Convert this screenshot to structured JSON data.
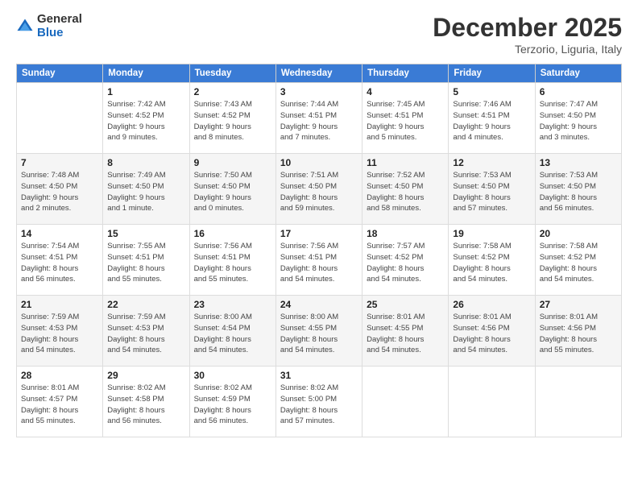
{
  "logo": {
    "general": "General",
    "blue": "Blue"
  },
  "title": "December 2025",
  "subtitle": "Terzorio, Liguria, Italy",
  "weekdays": [
    "Sunday",
    "Monday",
    "Tuesday",
    "Wednesday",
    "Thursday",
    "Friday",
    "Saturday"
  ],
  "weeks": [
    [
      {
        "day": "",
        "info": ""
      },
      {
        "day": "1",
        "info": "Sunrise: 7:42 AM\nSunset: 4:52 PM\nDaylight: 9 hours\nand 9 minutes."
      },
      {
        "day": "2",
        "info": "Sunrise: 7:43 AM\nSunset: 4:52 PM\nDaylight: 9 hours\nand 8 minutes."
      },
      {
        "day": "3",
        "info": "Sunrise: 7:44 AM\nSunset: 4:51 PM\nDaylight: 9 hours\nand 7 minutes."
      },
      {
        "day": "4",
        "info": "Sunrise: 7:45 AM\nSunset: 4:51 PM\nDaylight: 9 hours\nand 5 minutes."
      },
      {
        "day": "5",
        "info": "Sunrise: 7:46 AM\nSunset: 4:51 PM\nDaylight: 9 hours\nand 4 minutes."
      },
      {
        "day": "6",
        "info": "Sunrise: 7:47 AM\nSunset: 4:50 PM\nDaylight: 9 hours\nand 3 minutes."
      }
    ],
    [
      {
        "day": "7",
        "info": "Sunrise: 7:48 AM\nSunset: 4:50 PM\nDaylight: 9 hours\nand 2 minutes."
      },
      {
        "day": "8",
        "info": "Sunrise: 7:49 AM\nSunset: 4:50 PM\nDaylight: 9 hours\nand 1 minute."
      },
      {
        "day": "9",
        "info": "Sunrise: 7:50 AM\nSunset: 4:50 PM\nDaylight: 9 hours\nand 0 minutes."
      },
      {
        "day": "10",
        "info": "Sunrise: 7:51 AM\nSunset: 4:50 PM\nDaylight: 8 hours\nand 59 minutes."
      },
      {
        "day": "11",
        "info": "Sunrise: 7:52 AM\nSunset: 4:50 PM\nDaylight: 8 hours\nand 58 minutes."
      },
      {
        "day": "12",
        "info": "Sunrise: 7:53 AM\nSunset: 4:50 PM\nDaylight: 8 hours\nand 57 minutes."
      },
      {
        "day": "13",
        "info": "Sunrise: 7:53 AM\nSunset: 4:50 PM\nDaylight: 8 hours\nand 56 minutes."
      }
    ],
    [
      {
        "day": "14",
        "info": "Sunrise: 7:54 AM\nSunset: 4:51 PM\nDaylight: 8 hours\nand 56 minutes."
      },
      {
        "day": "15",
        "info": "Sunrise: 7:55 AM\nSunset: 4:51 PM\nDaylight: 8 hours\nand 55 minutes."
      },
      {
        "day": "16",
        "info": "Sunrise: 7:56 AM\nSunset: 4:51 PM\nDaylight: 8 hours\nand 55 minutes."
      },
      {
        "day": "17",
        "info": "Sunrise: 7:56 AM\nSunset: 4:51 PM\nDaylight: 8 hours\nand 54 minutes."
      },
      {
        "day": "18",
        "info": "Sunrise: 7:57 AM\nSunset: 4:52 PM\nDaylight: 8 hours\nand 54 minutes."
      },
      {
        "day": "19",
        "info": "Sunrise: 7:58 AM\nSunset: 4:52 PM\nDaylight: 8 hours\nand 54 minutes."
      },
      {
        "day": "20",
        "info": "Sunrise: 7:58 AM\nSunset: 4:52 PM\nDaylight: 8 hours\nand 54 minutes."
      }
    ],
    [
      {
        "day": "21",
        "info": "Sunrise: 7:59 AM\nSunset: 4:53 PM\nDaylight: 8 hours\nand 54 minutes."
      },
      {
        "day": "22",
        "info": "Sunrise: 7:59 AM\nSunset: 4:53 PM\nDaylight: 8 hours\nand 54 minutes."
      },
      {
        "day": "23",
        "info": "Sunrise: 8:00 AM\nSunset: 4:54 PM\nDaylight: 8 hours\nand 54 minutes."
      },
      {
        "day": "24",
        "info": "Sunrise: 8:00 AM\nSunset: 4:55 PM\nDaylight: 8 hours\nand 54 minutes."
      },
      {
        "day": "25",
        "info": "Sunrise: 8:01 AM\nSunset: 4:55 PM\nDaylight: 8 hours\nand 54 minutes."
      },
      {
        "day": "26",
        "info": "Sunrise: 8:01 AM\nSunset: 4:56 PM\nDaylight: 8 hours\nand 54 minutes."
      },
      {
        "day": "27",
        "info": "Sunrise: 8:01 AM\nSunset: 4:56 PM\nDaylight: 8 hours\nand 55 minutes."
      }
    ],
    [
      {
        "day": "28",
        "info": "Sunrise: 8:01 AM\nSunset: 4:57 PM\nDaylight: 8 hours\nand 55 minutes."
      },
      {
        "day": "29",
        "info": "Sunrise: 8:02 AM\nSunset: 4:58 PM\nDaylight: 8 hours\nand 56 minutes."
      },
      {
        "day": "30",
        "info": "Sunrise: 8:02 AM\nSunset: 4:59 PM\nDaylight: 8 hours\nand 56 minutes."
      },
      {
        "day": "31",
        "info": "Sunrise: 8:02 AM\nSunset: 5:00 PM\nDaylight: 8 hours\nand 57 minutes."
      },
      {
        "day": "",
        "info": ""
      },
      {
        "day": "",
        "info": ""
      },
      {
        "day": "",
        "info": ""
      }
    ]
  ]
}
